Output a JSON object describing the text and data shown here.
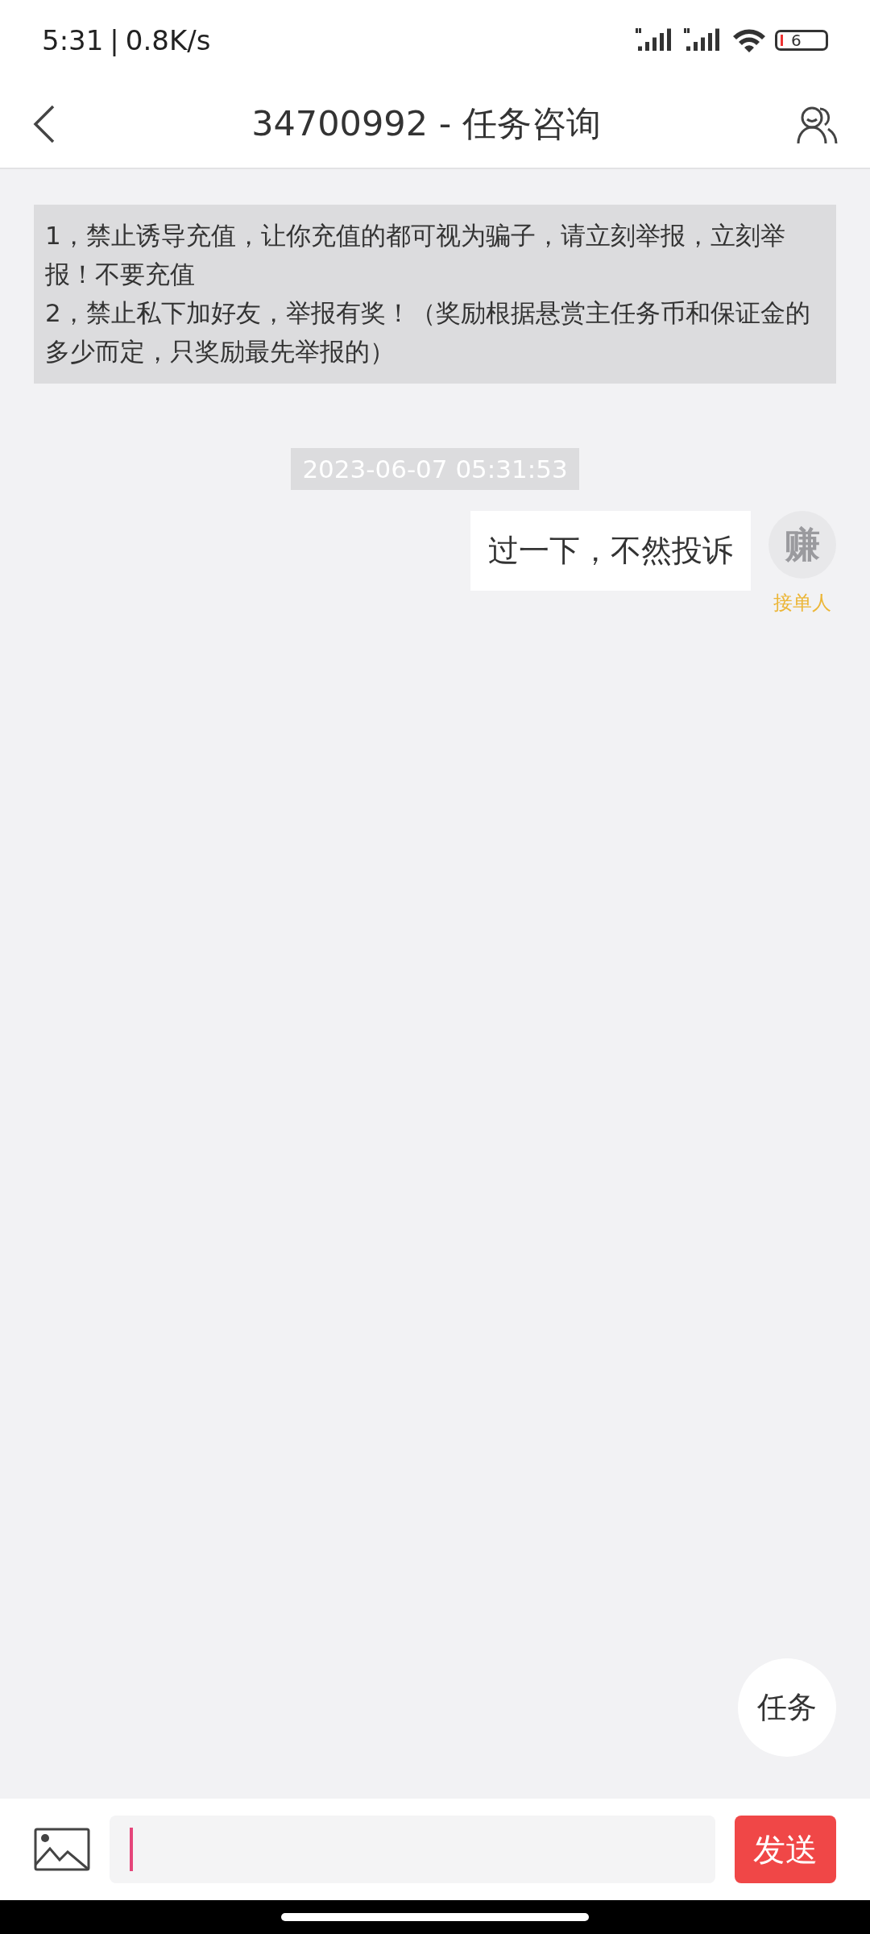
{
  "status_bar": {
    "time": "5:31",
    "separator": "|",
    "speed": "0.8K/s",
    "battery": "6"
  },
  "header": {
    "title": "34700992 - 任务咨询"
  },
  "notice": {
    "lines": [
      "1，禁止诱导充值，让你充值的都可视为骗子，请立刻举报，立刻举报！不要充值",
      "2，禁止私下加好友，举报有奖！（奖励根据悬赏主任务币和保证金的多少而定，只奖励最先举报的）"
    ]
  },
  "timestamp": "2023-06-07 05:31:53",
  "messages": [
    {
      "text": "过一下，不然投诉",
      "avatar": "赚",
      "role": "接单人"
    }
  ],
  "task_button": "任务",
  "composer": {
    "send": "发送"
  }
}
